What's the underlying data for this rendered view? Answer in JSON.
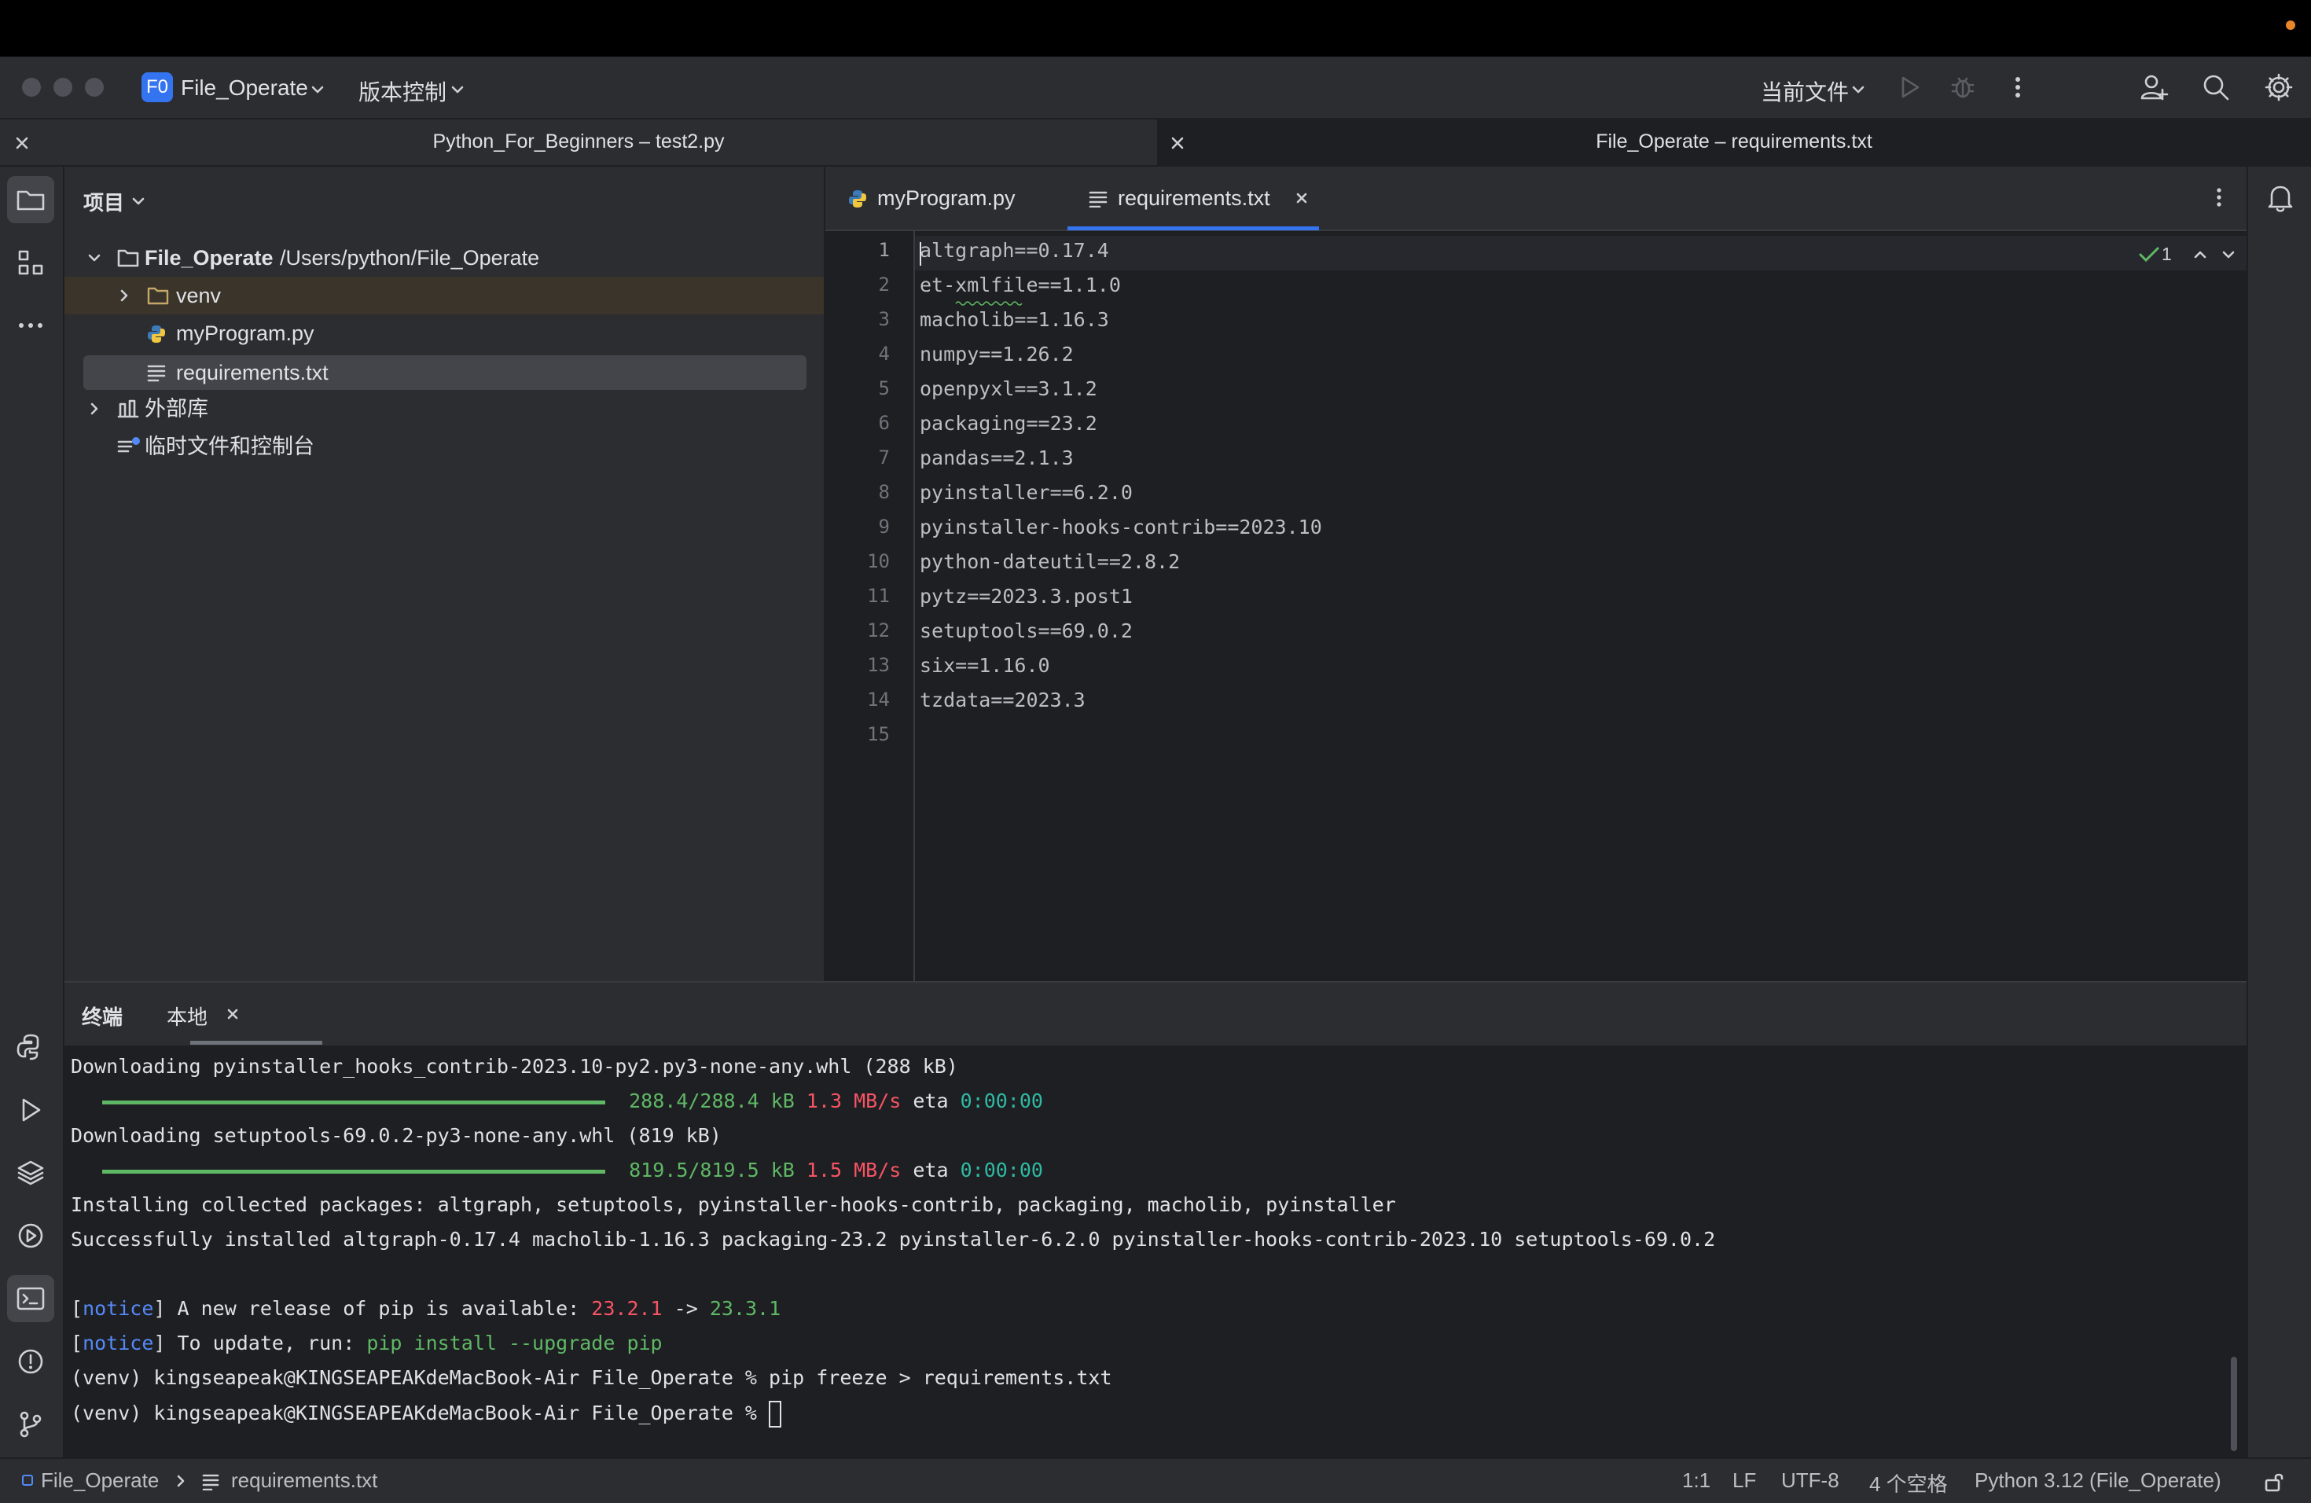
{
  "title_bar": {
    "project_badge": "F0",
    "project_name": "File_Operate",
    "vcs_label": "版本控制",
    "run_config": "当前文件"
  },
  "window_tabs": [
    {
      "title": "Python_For_Beginners – test2.py"
    },
    {
      "title": "File_Operate – requirements.txt"
    }
  ],
  "project_panel": {
    "title": "项目",
    "root_name": "File_Operate",
    "root_path": "/Users/python/File_Operate",
    "items": [
      {
        "label": "venv"
      },
      {
        "label": "myProgram.py"
      },
      {
        "label": "requirements.txt"
      },
      {
        "label": "外部库"
      },
      {
        "label": "临时文件和控制台"
      }
    ]
  },
  "editor": {
    "tabs": [
      {
        "label": "myProgram.py"
      },
      {
        "label": "requirements.txt"
      }
    ],
    "inspection_count": "1",
    "line_numbers": [
      "1",
      "2",
      "3",
      "4",
      "5",
      "6",
      "7",
      "8",
      "9",
      "10",
      "11",
      "12",
      "13",
      "14",
      "15"
    ],
    "lines": [
      "altgraph==0.17.4",
      "et-xmlfile==1.1.0",
      "macholib==1.16.3",
      "numpy==1.26.2",
      "openpyxl==3.1.2",
      "packaging==23.2",
      "pandas==2.1.3",
      "pyinstaller==6.2.0",
      "pyinstaller-hooks-contrib==2023.10",
      "python-dateutil==2.8.2",
      "pytz==2023.3.post1",
      "setuptools==69.0.2",
      "six==1.16.0",
      "tzdata==2023.3",
      ""
    ]
  },
  "terminal": {
    "title": "终端",
    "tab_label": "本地",
    "dl1": "Downloading pyinstaller_hooks_contrib-2023.10-py2.py3-none-any.whl (288 kB)",
    "p1_size": "288.4/288.4 kB",
    "p1_speed": "1.3 MB/s",
    "p1_eta_label": "eta",
    "p1_eta": "0:00:00",
    "p1_progress": 1.0,
    "dl2": "Downloading setuptools-69.0.2-py3-none-any.whl (819 kB)",
    "p2_size": "819.5/819.5 kB",
    "p2_speed": "1.5 MB/s",
    "p2_eta_label": "eta",
    "p2_eta": "0:00:00",
    "p2_progress": 1.0,
    "installing": "Installing collected packages: altgraph, setuptools, pyinstaller-hooks-contrib, packaging, macholib, pyinstaller",
    "success": "Successfully installed altgraph-0.17.4 macholib-1.16.3 packaging-23.2 pyinstaller-6.2.0 pyinstaller-hooks-contrib-2023.10 setuptools-69.0.2",
    "notice_tag": "notice",
    "notice1_text": "A new release of pip is available:",
    "notice1_old": "23.2.1",
    "notice1_arrow": "->",
    "notice1_new": "23.3.1",
    "notice2_text": "To update, run:",
    "notice2_cmd": "pip install --upgrade pip",
    "prompt1": "(venv) kingseapeak@KINGSEAPEAKdeMacBook-Air File_Operate % pip freeze > requirements.txt",
    "prompt2": "(venv) kingseapeak@KINGSEAPEAKdeMacBook-Air File_Operate % "
  },
  "status_bar": {
    "breadcrumb_project": "File_Operate",
    "breadcrumb_file": "requirements.txt",
    "position": "1:1",
    "line_sep": "LF",
    "encoding": "UTF-8",
    "indent": "4 个空格",
    "interpreter": "Python 3.12 (File_Operate)"
  },
  "colors": {
    "accent": "#3574f0",
    "background": "#1e1f22",
    "panel": "#2b2d30",
    "terminal_green": "#5fb865",
    "terminal_red": "#f75464",
    "terminal_cyan": "#2fbaa3",
    "terminal_blue": "#548af7"
  }
}
